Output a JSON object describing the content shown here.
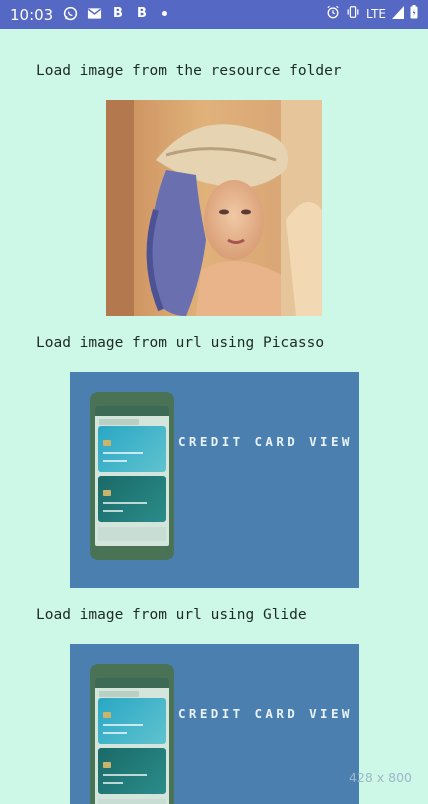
{
  "status_bar": {
    "time": "10:03",
    "left_icons": [
      "whatsapp-icon",
      "gmail-icon",
      "b-app-icon",
      "b-app-icon",
      "notification-dot-icon"
    ],
    "network": "LTE",
    "right_icons": [
      "alarm-icon",
      "vibrate-icon",
      "signal-icon",
      "battery-icon"
    ]
  },
  "sections": [
    {
      "caption": "Load image from the resource folder",
      "image": "portrait-photo"
    },
    {
      "caption": "Load image from url using Picasso",
      "image": "credit-card-view-banner",
      "banner_text": "CREDIT CARD VIEW"
    },
    {
      "caption": "Load image from url using Glide",
      "image": "credit-card-view-banner",
      "banner_text": "CREDIT CARD VIEW"
    }
  ],
  "watermark": "428 x 800",
  "colors": {
    "status_bar": "#5568c4",
    "background": "#cdf7e6",
    "banner": "#4a7fb0"
  }
}
